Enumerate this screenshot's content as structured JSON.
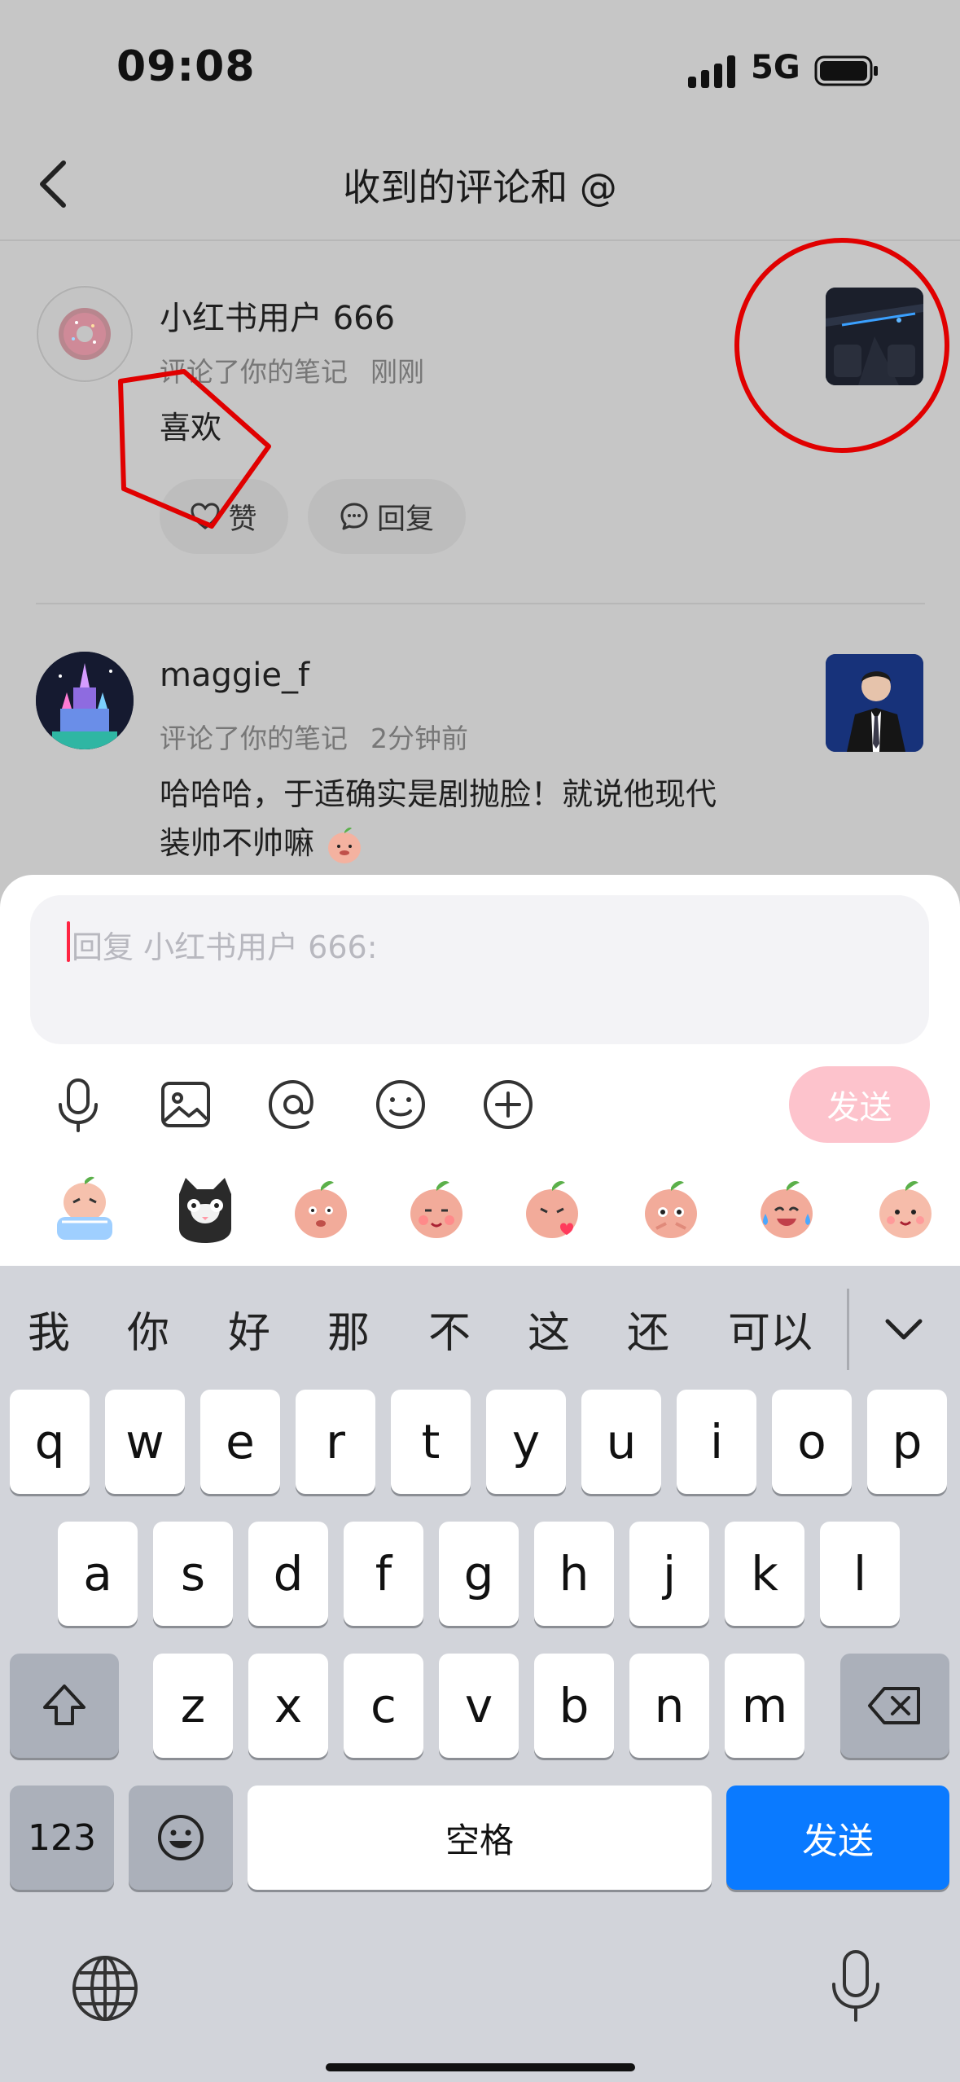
{
  "status": {
    "time": "09:08",
    "network": "5G"
  },
  "nav": {
    "title": "收到的评论和 @"
  },
  "comments": [
    {
      "name": "小红书用户 666",
      "action": "评论了你的笔记",
      "time": "刚刚",
      "text": "喜欢",
      "like_label": "赞",
      "reply_label": "回复"
    },
    {
      "name": "maggie_f",
      "action": "评论了你的笔记",
      "time": "2分钟前",
      "text_line1": "哈哈哈，于适确实是剧抛脸！就说他现代",
      "text_line2": "装帅不帅嘛"
    }
  ],
  "reply_box": {
    "placeholder": "回复 小红书用户 666:",
    "send_label": "发送"
  },
  "toolbar_icons": [
    "mic-icon",
    "image-icon",
    "at-icon",
    "emoji-icon",
    "plus-icon"
  ],
  "keyboard": {
    "candidates": [
      "我",
      "你",
      "好",
      "那",
      "不",
      "这",
      "还",
      "可以"
    ],
    "row1": [
      "q",
      "w",
      "e",
      "r",
      "t",
      "y",
      "u",
      "i",
      "o",
      "p"
    ],
    "row2": [
      "a",
      "s",
      "d",
      "f",
      "g",
      "h",
      "j",
      "k",
      "l"
    ],
    "row3": [
      "z",
      "x",
      "c",
      "v",
      "b",
      "n",
      "m"
    ],
    "num_label": "123",
    "space_label": "空格",
    "send_label": "发送"
  },
  "colors": {
    "accent": "#ff2442",
    "send_disabled": "#fdc3cc",
    "key_blue": "#0a7aff"
  }
}
